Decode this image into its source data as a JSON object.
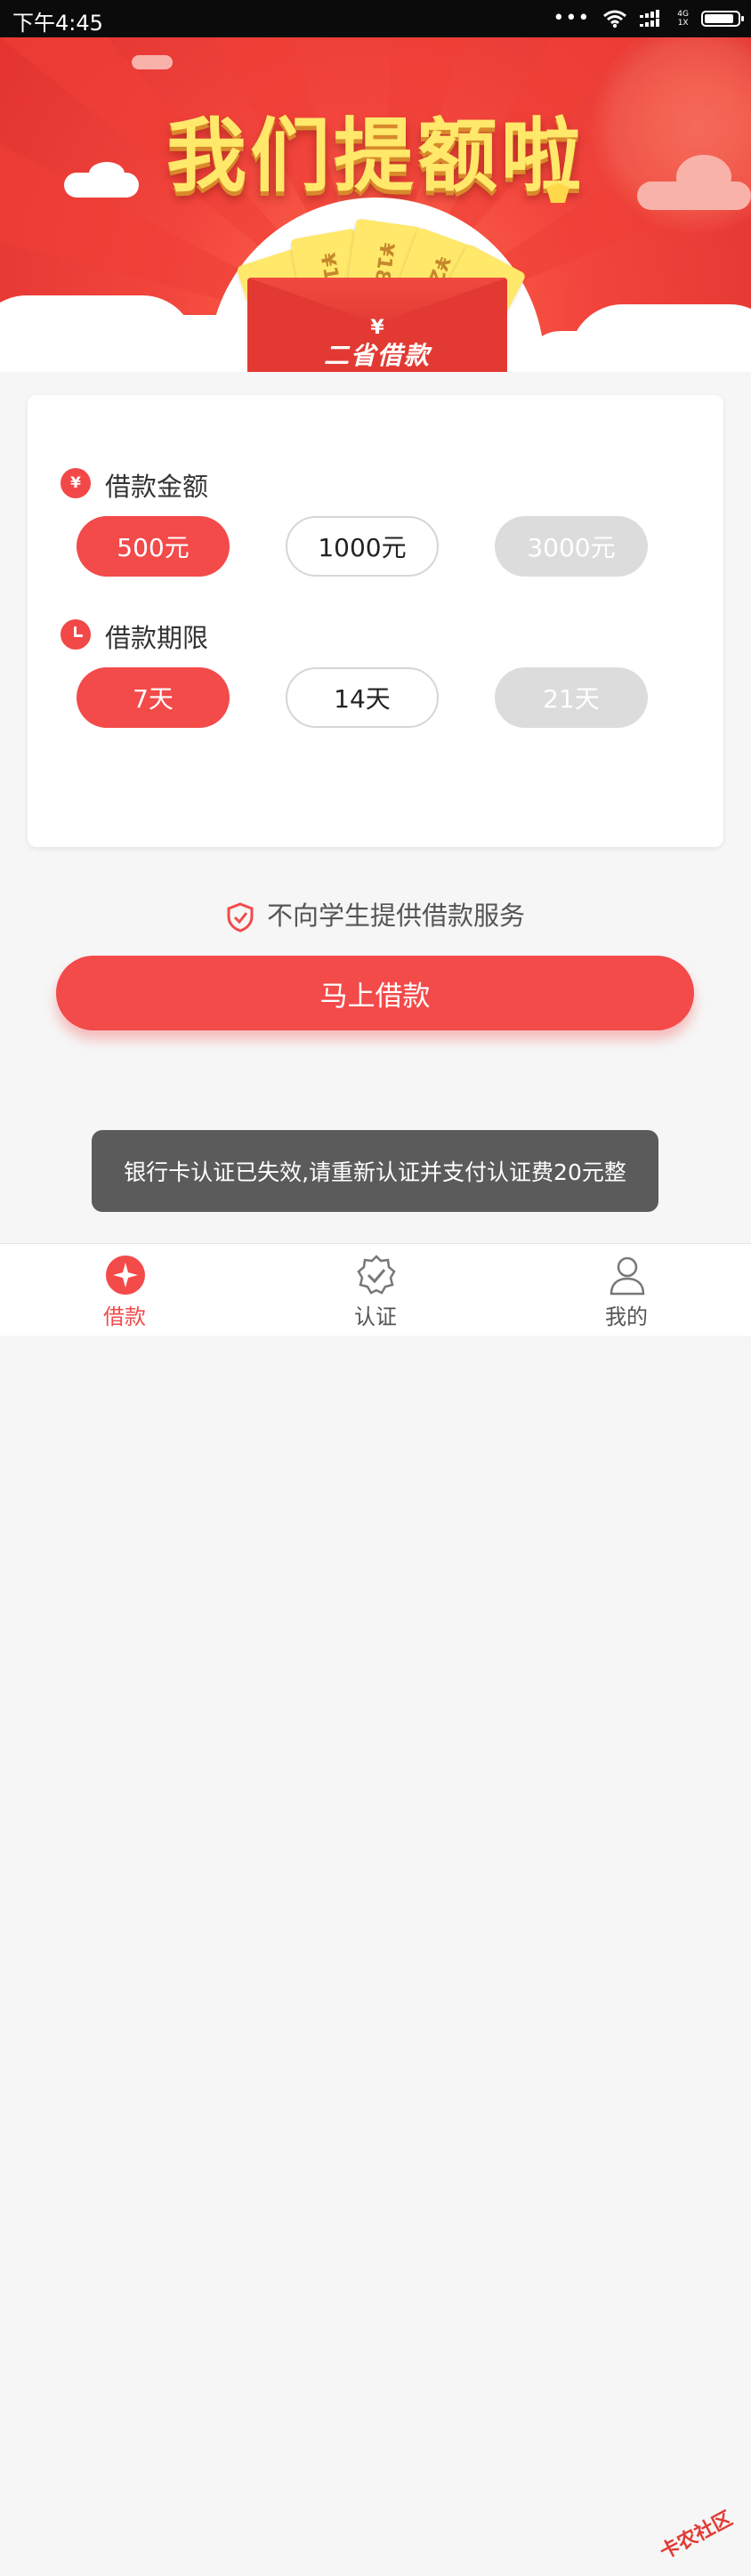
{
  "status_bar": {
    "time": "下午4:45",
    "network_top": "4G",
    "network_bottom": "1X",
    "battery_level": 0.9
  },
  "banner": {
    "title": "我们提额啦",
    "tickets": [
      "1200",
      "¥1500",
      "¥1800",
      "¥2000",
      "???"
    ],
    "envelope_symbol": "¥",
    "envelope_label": "二省借款"
  },
  "loan_form": {
    "amount_label": "借款金额",
    "amount_icon_text": "¥",
    "amount_options": [
      "500元",
      "1000元",
      "3000元"
    ],
    "term_label": "借款期限",
    "term_options": [
      "7天",
      "14天",
      "21天"
    ]
  },
  "notice": "不向学生提供借款服务",
  "cta_label": "马上借款",
  "toast": "银行卡认证已失效,请重新认证并支付认证费20元整",
  "tabs": [
    {
      "label": "借款",
      "icon": "loan-icon"
    },
    {
      "label": "认证",
      "icon": "verify-icon"
    },
    {
      "label": "我的",
      "icon": "profile-icon"
    }
  ],
  "watermark": "卡农社区",
  "colors": {
    "accent": "#f34a4a",
    "disabled": "#dcdcdc",
    "toast_bg": "#5b5b5b",
    "title_yellow": "#ffe86a"
  }
}
